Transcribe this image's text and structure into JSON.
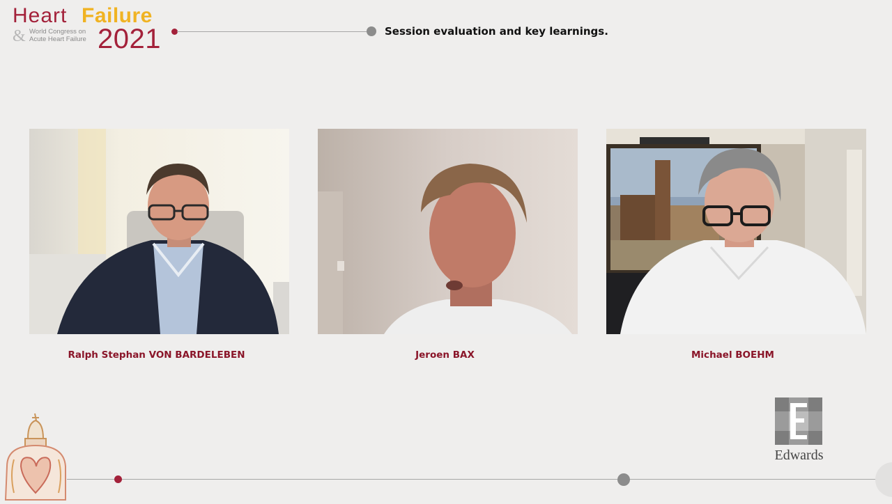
{
  "header": {
    "logo": {
      "word1": "Heart",
      "word2": "Failure",
      "ampersand": "&",
      "subtitle_line1": "World Congress on",
      "subtitle_line2": "Acute Heart Failure",
      "year": "2021"
    },
    "session_title": "Session evaluation and key learnings."
  },
  "participants": [
    {
      "name": "Ralph Stephan VON BARDELEBEN",
      "video": "participant-video"
    },
    {
      "name": "Jeroen BAX",
      "video": "participant-video"
    },
    {
      "name": "Michael BOEHM",
      "video": "participant-video"
    }
  ],
  "sponsor": {
    "name": "Edwards",
    "icon": "edwards-logo-icon"
  },
  "colors": {
    "brand_red": "#a3213a",
    "brand_yellow": "#f0b323",
    "name_red": "#8a1529",
    "timeline_grey": "#8c8c8c",
    "background": "#efeeed"
  }
}
